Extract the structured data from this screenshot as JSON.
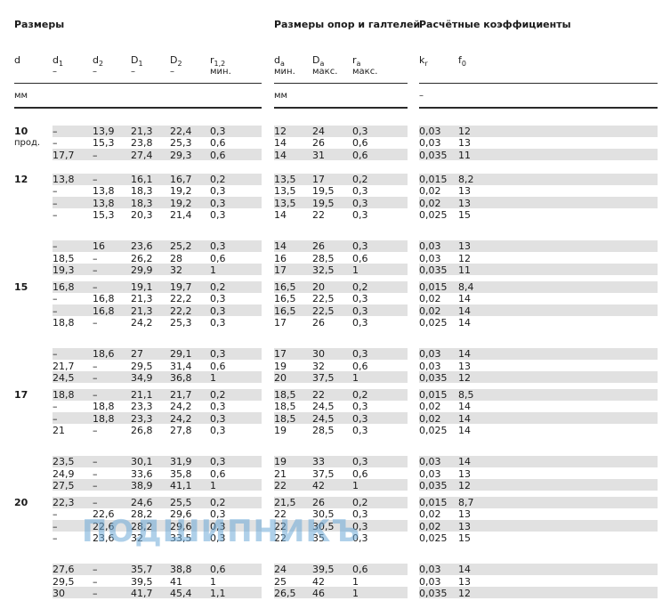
{
  "groups": {
    "sizes": "Размеры",
    "supports": "Размеры опор и галтелей",
    "coefficients": "Расчётные коэффициенты"
  },
  "columns": [
    {
      "main": "d",
      "sub": "",
      "line2": ""
    },
    {
      "main": "d",
      "sub": "1",
      "line2": "–"
    },
    {
      "main": "d",
      "sub": "2",
      "line2": "–"
    },
    {
      "main": "D",
      "sub": "1",
      "line2": "–"
    },
    {
      "main": "D",
      "sub": "2",
      "line2": "–"
    },
    {
      "main": "r",
      "sub": "1,2",
      "line2": "мин."
    },
    {
      "main": "d",
      "sub": "a",
      "line2": "мин."
    },
    {
      "main": "D",
      "sub": "a",
      "line2": "макс."
    },
    {
      "main": "r",
      "sub": "a",
      "line2": "макс."
    },
    {
      "main": "k",
      "sub": "r",
      "line2": ""
    },
    {
      "main": "f",
      "sub": "0",
      "line2": ""
    }
  ],
  "units": {
    "sizes": "мм",
    "supports": "мм",
    "coefficients": "–"
  },
  "groups_data": [
    {
      "d": "10",
      "d_sub": "прод.",
      "blocks": [
        [
          [
            "–",
            "13,9",
            "21,3",
            "22,4",
            "0,3",
            "12",
            "24",
            "0,3",
            "0,03",
            "12"
          ],
          [
            "–",
            "15,3",
            "23,8",
            "25,3",
            "0,6",
            "14",
            "26",
            "0,6",
            "0,03",
            "13"
          ],
          [
            "17,7",
            "–",
            "27,4",
            "29,3",
            "0,6",
            "14",
            "31",
            "0,6",
            "0,035",
            "11"
          ]
        ]
      ]
    },
    {
      "d": "12",
      "d_sub": "",
      "blocks": [
        [
          [
            "13,8",
            "–",
            "16,1",
            "16,7",
            "0,2",
            "13,5",
            "17",
            "0,2",
            "0,015",
            "8,2"
          ],
          [
            "–",
            "13,8",
            "18,3",
            "19,2",
            "0,3",
            "13,5",
            "19,5",
            "0,3",
            "0,02",
            "13"
          ],
          [
            "–",
            "13,8",
            "18,3",
            "19,2",
            "0,3",
            "13,5",
            "19,5",
            "0,3",
            "0,02",
            "13"
          ],
          [
            "–",
            "15,3",
            "20,3",
            "21,4",
            "0,3",
            "14",
            "22",
            "0,3",
            "0,025",
            "15"
          ]
        ],
        [
          [
            "–",
            "16",
            "23,6",
            "25,2",
            "0,3",
            "14",
            "26",
            "0,3",
            "0,03",
            "13"
          ],
          [
            "18,5",
            "–",
            "26,2",
            "28",
            "0,6",
            "16",
            "28,5",
            "0,6",
            "0,03",
            "12"
          ],
          [
            "19,3",
            "–",
            "29,9",
            "32",
            "1",
            "17",
            "32,5",
            "1",
            "0,035",
            "11"
          ]
        ]
      ]
    },
    {
      "d": "15",
      "d_sub": "",
      "blocks": [
        [
          [
            "16,8",
            "–",
            "19,1",
            "19,7",
            "0,2",
            "16,5",
            "20",
            "0,2",
            "0,015",
            "8,4"
          ],
          [
            "–",
            "16,8",
            "21,3",
            "22,2",
            "0,3",
            "16,5",
            "22,5",
            "0,3",
            "0,02",
            "14"
          ],
          [
            "–",
            "16,8",
            "21,3",
            "22,2",
            "0,3",
            "16,5",
            "22,5",
            "0,3",
            "0,02",
            "14"
          ],
          [
            "18,8",
            "–",
            "24,2",
            "25,3",
            "0,3",
            "17",
            "26",
            "0,3",
            "0,025",
            "14"
          ]
        ],
        [
          [
            "–",
            "18,6",
            "27",
            "29,1",
            "0,3",
            "17",
            "30",
            "0,3",
            "0,03",
            "14"
          ],
          [
            "21,7",
            "–",
            "29,5",
            "31,4",
            "0,6",
            "19",
            "32",
            "0,6",
            "0,03",
            "13"
          ],
          [
            "24,5",
            "–",
            "34,9",
            "36,8",
            "1",
            "20",
            "37,5",
            "1",
            "0,035",
            "12"
          ]
        ]
      ]
    },
    {
      "d": "17",
      "d_sub": "",
      "blocks": [
        [
          [
            "18,8",
            "–",
            "21,1",
            "21,7",
            "0,2",
            "18,5",
            "22",
            "0,2",
            "0,015",
            "8,5"
          ],
          [
            "–",
            "18,8",
            "23,3",
            "24,2",
            "0,3",
            "18,5",
            "24,5",
            "0,3",
            "0,02",
            "14"
          ],
          [
            "–",
            "18,8",
            "23,3",
            "24,2",
            "0,3",
            "18,5",
            "24,5",
            "0,3",
            "0,02",
            "14"
          ],
          [
            "21",
            "–",
            "26,8",
            "27,8",
            "0,3",
            "19",
            "28,5",
            "0,3",
            "0,025",
            "14"
          ]
        ],
        [
          [
            "23,5",
            "–",
            "30,1",
            "31,9",
            "0,3",
            "19",
            "33",
            "0,3",
            "0,03",
            "14"
          ],
          [
            "24,9",
            "–",
            "33,6",
            "35,8",
            "0,6",
            "21",
            "37,5",
            "0,6",
            "0,03",
            "13"
          ],
          [
            "27,5",
            "–",
            "38,9",
            "41,1",
            "1",
            "22",
            "42",
            "1",
            "0,035",
            "12"
          ]
        ]
      ]
    },
    {
      "d": "20",
      "d_sub": "",
      "blocks": [
        [
          [
            "22,3",
            "–",
            "24,6",
            "25,5",
            "0,2",
            "21,5",
            "26",
            "0,2",
            "0,015",
            "8,7"
          ],
          [
            "–",
            "22,6",
            "28,2",
            "29,6",
            "0,3",
            "22",
            "30,5",
            "0,3",
            "0,02",
            "13"
          ],
          [
            "–",
            "22,6",
            "28,2",
            "29,6",
            "0,3",
            "22",
            "30,5",
            "0,3",
            "0,02",
            "13"
          ],
          [
            "–",
            "23,6",
            "32",
            "33,5",
            "0,3",
            "22",
            "35",
            "0,3",
            "0,025",
            "15"
          ]
        ],
        [
          [
            "27,6",
            "–",
            "35,7",
            "38,8",
            "0,6",
            "24",
            "39,5",
            "0,6",
            "0,03",
            "14"
          ],
          [
            "29,5",
            "–",
            "39,5",
            "41",
            "1",
            "25",
            "42",
            "1",
            "0,03",
            "13"
          ],
          [
            "30",
            "–",
            "41,7",
            "45,4",
            "1,1",
            "26,5",
            "46",
            "1",
            "0,035",
            "12"
          ]
        ]
      ]
    }
  ],
  "watermark": "ПОДШИПНИКЪ"
}
